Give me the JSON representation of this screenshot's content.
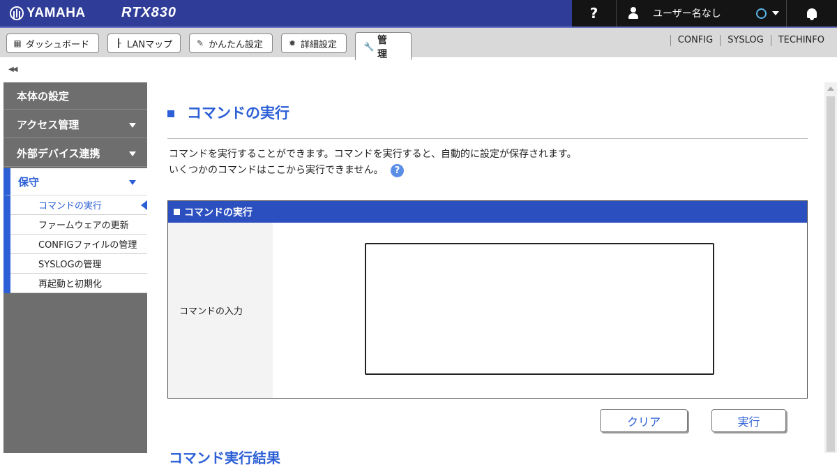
{
  "header": {
    "brand": "YAMAHA",
    "model": "RTX830",
    "help_label": "?",
    "user_label": "ユーザー名なし",
    "colors": {
      "top": "#2f3d99",
      "dark": "#141414",
      "accent": "#2c5fd6"
    }
  },
  "tabs": [
    {
      "label": "ダッシュボード",
      "icon": "dashboard-icon"
    },
    {
      "label": "LANマップ",
      "icon": "lan-map-icon"
    },
    {
      "label": "かんたん設定",
      "icon": "wizard-icon"
    },
    {
      "label": "詳細設定",
      "icon": "gear-icon"
    },
    {
      "label": "管　理",
      "icon": "wrench-icon",
      "active": true
    }
  ],
  "toplinks": [
    "CONFIG",
    "SYSLOG",
    "TECHINFO"
  ],
  "collapse_label": "◀◀",
  "sidebar": {
    "items": [
      {
        "label": "本体の設定"
      },
      {
        "label": "アクセス管理"
      },
      {
        "label": "外部デバイス連携"
      },
      {
        "label": "保守"
      }
    ],
    "sub_items": [
      {
        "label": "コマンドの実行"
      },
      {
        "label": "ファームウェアの更新"
      },
      {
        "label": "CONFIGファイルの管理"
      },
      {
        "label": "SYSLOGの管理"
      },
      {
        "label": "再起動と初期化"
      }
    ]
  },
  "main": {
    "title": "コマンドの実行",
    "desc_line1": "コマンドを実行することができます。コマンドを実行すると、自動的に設定が保存されます。",
    "desc_line2": "いくつかのコマンドはここから実行できません。",
    "help_icon": "?",
    "panel_title": "コマンドの実行",
    "input_label": "コマンドの入力",
    "input_value": "",
    "clear_label": "クリア",
    "exec_label": "実行",
    "result_title": "コマンド実行結果"
  }
}
